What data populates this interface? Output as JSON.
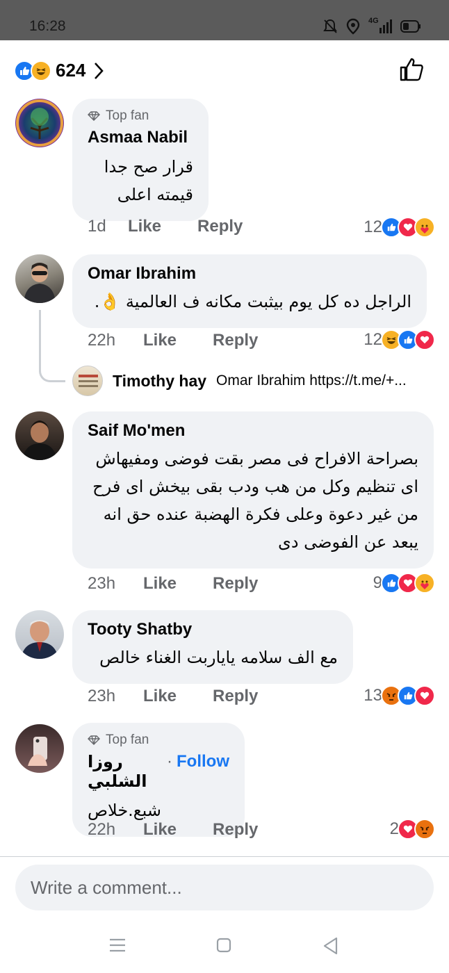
{
  "status_bar": {
    "time": "16:28",
    "network": "4G"
  },
  "header": {
    "reaction_count": "624",
    "reaction_icons": [
      "like-icon",
      "haha-icon"
    ],
    "like_button_icon": "thumbs-up-outline-icon"
  },
  "comments": [
    {
      "badge": "Top fan",
      "author": "Asmaa Nabil",
      "lines": [
        "قرار صح جدا",
        "قيمته اعلى"
      ],
      "time": "1d",
      "like_label": "Like",
      "reply_label": "Reply",
      "reaction_count": "12",
      "reactions": [
        "like-icon",
        "love-icon",
        "care-icon"
      ]
    },
    {
      "author": "Omar Ibrahim",
      "lines": [
        "الراجل ده كل يوم بيثبت مكانه ف العالمية 👌."
      ],
      "time": "22h",
      "like_label": "Like",
      "reply_label": "Reply",
      "reaction_count": "12",
      "reactions": [
        "haha-icon",
        "like-icon",
        "love-icon"
      ],
      "reply": {
        "author": "Timothy hay",
        "text": "Omar Ibrahim https://t.me/+..."
      }
    },
    {
      "author": "Saif Mo'men",
      "lines": [
        "بصراحة الافراح فى مصر بقت فوضى ومفيهاش",
        "اى تنظيم وكل من هب ودب بقى بيخش اى فرح",
        "من غير دعوة وعلى فكرة الهضبة عنده حق انه",
        "يبعد عن الفوضى دى"
      ],
      "time": "23h",
      "like_label": "Like",
      "reply_label": "Reply",
      "reaction_count": "9",
      "reactions": [
        "like-icon",
        "love-icon",
        "care-icon"
      ]
    },
    {
      "author": "Tooty Shatby",
      "lines": [
        "مع الف سلامه ياياربت الغناء خالص"
      ],
      "time": "23h",
      "like_label": "Like",
      "reply_label": "Reply",
      "reaction_count": "13",
      "reactions": [
        "angry-icon",
        "like-icon",
        "love-icon"
      ]
    },
    {
      "badge": "Top fan",
      "author": "روزا الشلبي",
      "follow_label": "Follow",
      "lines": [
        "شبع.خلاص"
      ],
      "time": "22h",
      "like_label": "Like",
      "reply_label": "Reply",
      "reaction_count": "2",
      "reactions": [
        "love-icon",
        "angry-icon"
      ]
    }
  ],
  "composer": {
    "placeholder": "Write a comment..."
  },
  "nav": {
    "icons": [
      "menu-icon",
      "home-square-icon",
      "back-triangle-icon"
    ]
  },
  "colors": {
    "accent": "#1877f2",
    "bubble": "#f0f2f5",
    "secondary_text": "#65676b",
    "love": "#f0284a",
    "angry": "#e9710f",
    "haha": "#f7b125"
  }
}
